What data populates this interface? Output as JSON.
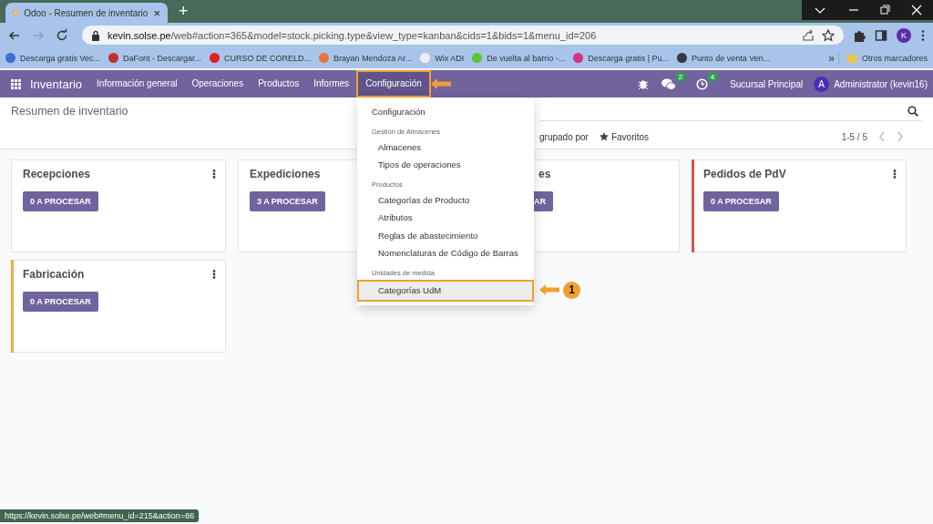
{
  "browser": {
    "tab": {
      "title": "Odoo - Resumen de inventario",
      "close": "×",
      "new_tab": "+"
    },
    "url": {
      "host": "kevin.solse.pe",
      "path": "/web#action=365&model=stock.picking.type&view_type=kanban&cids=1&bids=1&menu_id=206"
    },
    "profile_initial": "K",
    "bookmarks": [
      {
        "label": "Descarga gratis Vec...",
        "color": "#3b6fd6"
      },
      {
        "label": "DaFont - Descargar...",
        "color": "#c0302a"
      },
      {
        "label": "CURSO DE CORELD...",
        "color": "#e02020"
      },
      {
        "label": "Brayan Mendoza Ar...",
        "color": "#e8743b"
      },
      {
        "label": "Wix ADI",
        "color": "#eeeeee"
      },
      {
        "label": "De vuelta al barrio -...",
        "color": "#5bc236"
      },
      {
        "label": "Descarga gratis | Pu...",
        "color": "#d63384"
      },
      {
        "label": "Punto de venta Ven...",
        "color": "#333b45"
      }
    ],
    "bookmarks_more": "»",
    "other_bookmarks": "Otros marcadores"
  },
  "navbar": {
    "app": "Inventario",
    "menus": [
      {
        "label": "Información general",
        "selected": false,
        "highlighted": false
      },
      {
        "label": "Operaciones",
        "selected": false,
        "highlighted": false
      },
      {
        "label": "Productos",
        "selected": false,
        "highlighted": false
      },
      {
        "label": "Informes",
        "selected": false,
        "highlighted": false
      },
      {
        "label": "Configuración",
        "selected": true,
        "highlighted": true
      }
    ],
    "messages_count": "2",
    "activities_count": "4",
    "company": "Sucursal Principal",
    "user_initial": "A",
    "user": "Administrator (kevin16)"
  },
  "control_panel": {
    "breadcrumb": "Resumen de inventario",
    "group_by": "grupado por",
    "favorites": "Favoritos",
    "pager": "1-5 / 5"
  },
  "cards": [
    {
      "title": "Recepciones",
      "button": "0 A PROCESAR",
      "kind": "full"
    },
    {
      "title": "Expediciones",
      "button": "3 A PROCESAR",
      "kind": "full"
    },
    {
      "title": "es",
      "button": "AR",
      "kind": "partial"
    },
    {
      "title": "Pedidos de PdV",
      "button": "0 A PROCESAR",
      "kind": "full",
      "color": "#d9534f"
    },
    {
      "title": "Fabricación",
      "button": "0 A PROCESAR",
      "kind": "full",
      "color": "#f0ad4e"
    }
  ],
  "dropdown": {
    "items": [
      {
        "label": "Configuración",
        "kind": "item",
        "selected": false,
        "highlighted": false
      },
      {
        "label": "Gestión de Almacenes",
        "kind": "header"
      },
      {
        "label": "Almacenes",
        "kind": "subitem",
        "selected": false,
        "highlighted": false
      },
      {
        "label": "Tipos de operaciones",
        "kind": "subitem",
        "selected": false,
        "highlighted": false
      },
      {
        "label": "Productos",
        "kind": "header"
      },
      {
        "label": "Categorías de Producto",
        "kind": "subitem",
        "selected": false,
        "highlighted": false
      },
      {
        "label": "Atributos",
        "kind": "subitem",
        "selected": false,
        "highlighted": false
      },
      {
        "label": "Reglas de abastecimiento",
        "kind": "subitem",
        "selected": false,
        "highlighted": false
      },
      {
        "label": "Nomenclaturas de Código de Barras",
        "kind": "subitem",
        "selected": false,
        "highlighted": false
      },
      {
        "label": "Unidades de medida",
        "kind": "header"
      },
      {
        "label": "Categorías UdM",
        "kind": "subitem",
        "selected": true,
        "highlighted": true
      }
    ]
  },
  "callout": {
    "number": "1"
  },
  "status_url": "https://kevin.solse.pe/web#menu_id=215&action=86"
}
